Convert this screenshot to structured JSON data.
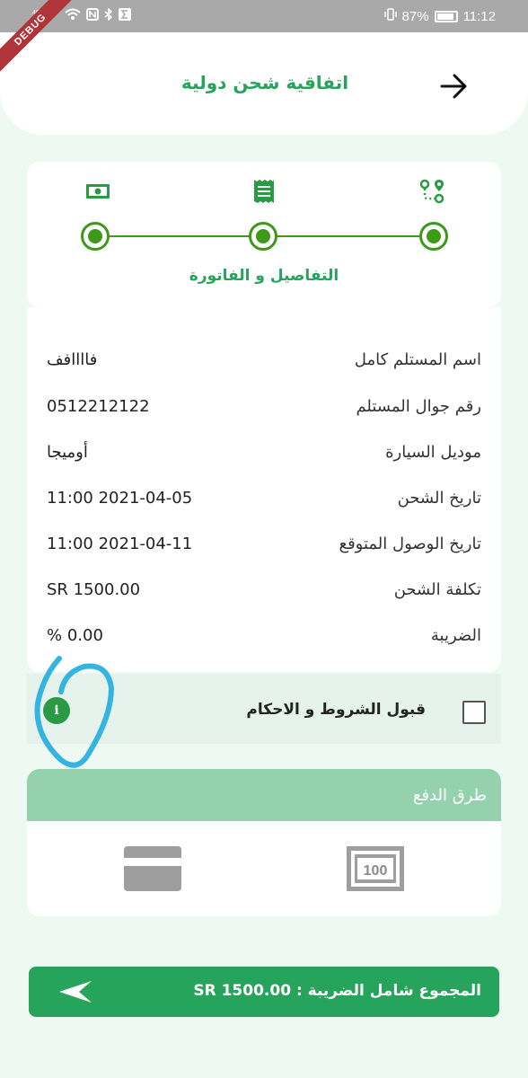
{
  "status_bar": {
    "left_icons": [
      "4G signal",
      "wifi-icon",
      "nfc-icon",
      "bluetooth-icon",
      "sigma-icon"
    ],
    "signal_text": "4G",
    "battery_percent": "87%",
    "time": "11:12"
  },
  "debug_banner": "DEBUG",
  "header": {
    "title": "اتفاقية شحن دولية",
    "back_icon": "arrow-right-icon"
  },
  "stepper": {
    "steps": [
      {
        "icon": "route-icon",
        "completed": true
      },
      {
        "icon": "receipt-icon",
        "completed": true
      },
      {
        "icon": "money-icon",
        "completed": true
      }
    ],
    "active_label": "التفاصيل و الفاتورة",
    "accent_color": "#3c9a17"
  },
  "details": {
    "rows": [
      {
        "label": "اسم المستلم كامل",
        "value": "فاااافف"
      },
      {
        "label": "رقم جوال المستلم",
        "value": "0512212122"
      },
      {
        "label": "موديل السيارة",
        "value": "أوميجا"
      },
      {
        "label": "تاريخ الشحن",
        "value": "11:00 2021-04-05"
      },
      {
        "label": "تاريخ الوصول المتوقع",
        "value": "11:00 2021-04-11"
      },
      {
        "label": "تكلفة الشحن",
        "value": "SR 1500.00"
      },
      {
        "label": "الضريبة",
        "value": "% 0.00"
      }
    ]
  },
  "terms": {
    "label": "قبول الشروط و الاحكام",
    "checked": false,
    "info_icon": "i"
  },
  "payment": {
    "title": "طرق الدفع",
    "methods": [
      "credit-card-icon",
      "cash-icon"
    ],
    "cash_note_text": "100"
  },
  "total_button": {
    "label": "المجموع شامل الضريبة : SR 1500.00",
    "icon": "send-icon",
    "color": "#27a45b"
  }
}
